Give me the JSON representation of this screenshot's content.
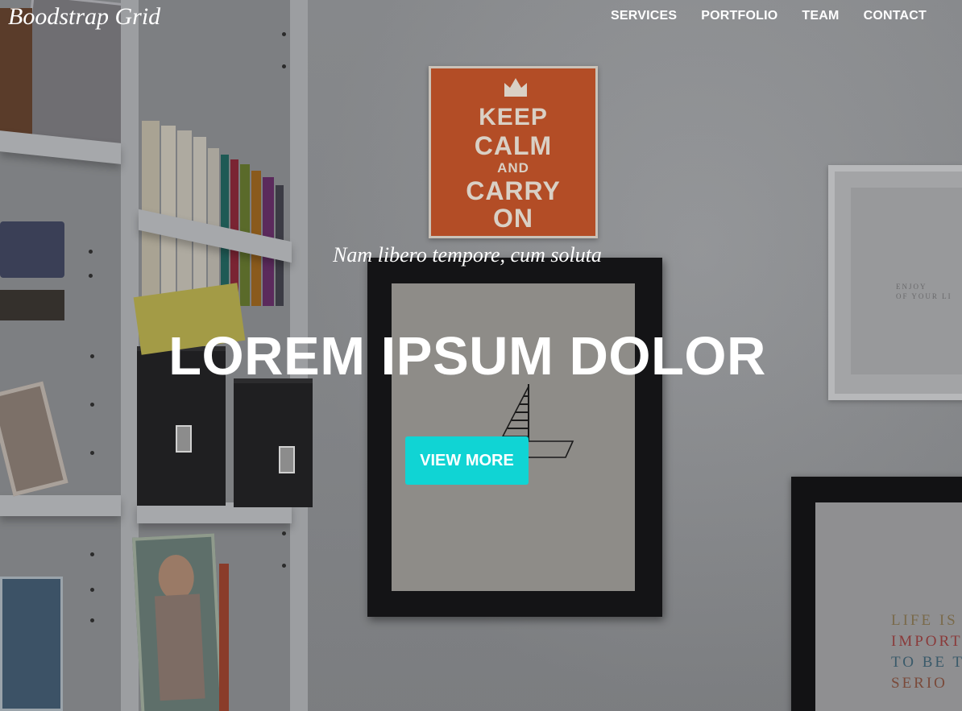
{
  "nav": {
    "brand": "Boodstrap Grid",
    "items": [
      {
        "label": "SERVICES"
      },
      {
        "label": "PORTFOLIO"
      },
      {
        "label": "TEAM"
      },
      {
        "label": "CONTACT"
      }
    ]
  },
  "hero": {
    "subtitle": "Nam libero tempore, cum soluta",
    "title": "LOREM IPSUM DOLOR",
    "button_label": "VIEW MORE",
    "button_color": "#10d4d4"
  },
  "background": {
    "poster_lines": [
      "KEEP",
      "CALM",
      "AND",
      "CARRY",
      "ON"
    ],
    "wall_print_lines": [
      "LIFE IS",
      "IMPORT",
      "TO BE T",
      "SERIO"
    ],
    "small_print_lines": [
      "ENJOY",
      "OF YOUR LI"
    ],
    "poster_color": "#b34d26"
  }
}
